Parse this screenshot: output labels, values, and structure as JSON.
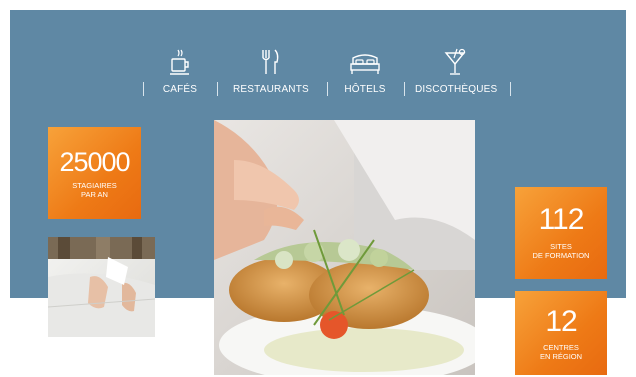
{
  "nav": {
    "items": [
      {
        "label": "CAFÉS",
        "icon": "coffee-cup-icon"
      },
      {
        "label": "RESTAURANTS",
        "icon": "fork-knife-icon"
      },
      {
        "label": "HÔTELS",
        "icon": "bed-icon"
      },
      {
        "label": "DISCOTHÈQUES",
        "icon": "cocktail-icon"
      }
    ]
  },
  "stats": {
    "trainees": {
      "value": "25000",
      "caption_1": "STAGIAIRES",
      "caption_2": "PAR AN"
    },
    "sites": {
      "value": "112",
      "caption_1": "SITES",
      "caption_2": "DE FORMATION"
    },
    "centres": {
      "value": "12",
      "caption_1": "CENTRES",
      "caption_2": "EN RÉGION"
    }
  },
  "colors": {
    "band": "#5f88a4",
    "accent_orange": "#ee7a16"
  }
}
